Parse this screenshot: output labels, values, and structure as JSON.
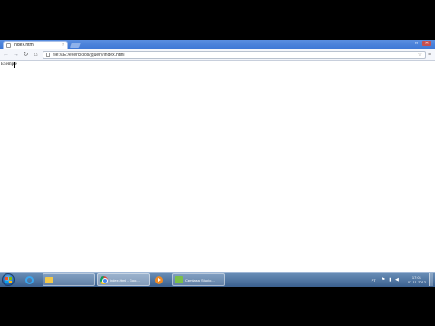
{
  "browser": {
    "tab_title": "index.html",
    "tab_close": "×",
    "address": "file:///E:/exercicios/jquery/index.html",
    "window_controls": {
      "minimize": "–",
      "maximize": "□",
      "close": "✕"
    }
  },
  "toolbar": {
    "back": "←",
    "forward": "→",
    "reload": "↻",
    "home": "⌂",
    "star": "☆",
    "menu": "≡"
  },
  "page": {
    "text": "Exemple"
  },
  "taskbar": {
    "items": [
      {
        "icon": "ie-icon",
        "label": ""
      },
      {
        "icon": "folder-icon",
        "label": ""
      },
      {
        "icon": "chrome-icon",
        "label": "index.html - Goo..."
      },
      {
        "icon": "media-player-icon",
        "label": ""
      },
      {
        "icon": "camtasia-icon",
        "label": "Camtasia Studio..."
      }
    ],
    "tray": {
      "language": "PT",
      "time": "17:01",
      "date": "07-11-2012"
    }
  },
  "colors": {
    "titlebar": "#3f78d6",
    "taskbar": "#3a5f8e"
  }
}
